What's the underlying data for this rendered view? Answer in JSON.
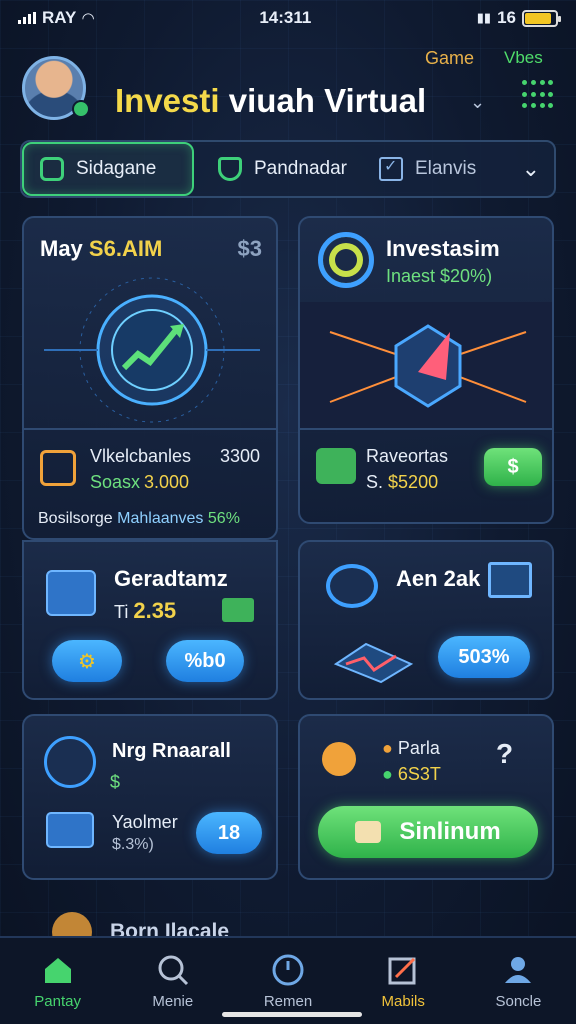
{
  "status": {
    "carrier": "RAY",
    "time": "14:311",
    "battery_label": "16",
    "battery_level": 0.85
  },
  "header": {
    "title_highlight": "Investi",
    "title_rest": "viuah Virtual",
    "game_label": "Game",
    "vibes_label": "Vbes"
  },
  "tabs": [
    {
      "label": "Sidagane",
      "active": true
    },
    {
      "label": "Pandnadar",
      "active": false
    },
    {
      "label": "Elanvis",
      "active": false
    }
  ],
  "card_left_top": {
    "title_prefix": "May",
    "title_accent": "S6.AIM",
    "corner": "$3",
    "row1_label": "Vlkelcbanles",
    "row1_value": "3300",
    "row2_label": "Soasx",
    "row2_value": "3.000",
    "row3_label": "Bosilsorge",
    "row3_accent": "Mahlaanves",
    "row3_value": "56%"
  },
  "card_right_top": {
    "title": "Investasim",
    "subtitle": "Inaest $20%)",
    "row1_label": "Raveortas",
    "row2_label": "S.",
    "row2_value": "$5200",
    "button_label": "$"
  },
  "card_left_mid": {
    "title": "Geradtamz",
    "value_prefix": "Ti",
    "value": "2.35",
    "button2_label": "%b0"
  },
  "card_right_mid": {
    "title": "Aen 2ak",
    "button_label": "503%"
  },
  "card_left_bottom": {
    "title": "Nrg Rnaarall",
    "subvalue": "$",
    "row_label": "Yaolmer",
    "row_value": "$.3%)",
    "button_label": "18"
  },
  "card_right_bottom": {
    "row1_label": "Parla",
    "row2_label": "6S3T",
    "button_label": "Sinlinum"
  },
  "partial_title": "Born Ilacale",
  "bottom_nav": [
    {
      "label": "Pantay",
      "icon": "home-icon"
    },
    {
      "label": "Menie",
      "icon": "search-icon"
    },
    {
      "label": "Remen",
      "icon": "clock-icon"
    },
    {
      "label": "Mabils",
      "icon": "edit-icon"
    },
    {
      "label": "Soncle",
      "icon": "user-icon"
    }
  ],
  "colors": {
    "accent_green": "#3ed07a",
    "accent_yellow": "#f4d94a",
    "accent_blue": "#1f7fe0"
  }
}
